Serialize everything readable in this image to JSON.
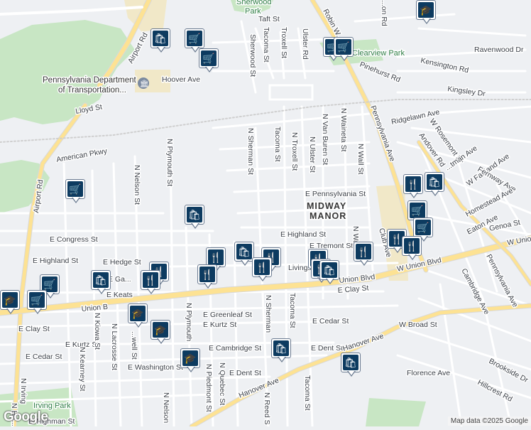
{
  "map": {
    "areas": {
      "midway_manor_line1": "MIDWAY",
      "midway_manor_line2": "MANOR"
    },
    "parks": {
      "sherwood_top": "Sherwood",
      "sherwood_bottom": "Park",
      "clearview": "Clearview Park",
      "irving": "Irving Park"
    },
    "poi": {
      "penndot_line1": "Pennsylvania Department",
      "penndot_line2": "of Transportation..."
    },
    "streets": {
      "airport_rd_n": "Airport Rd",
      "airport_rd_s": "Airport Rd",
      "hoover": "Hoover Ave",
      "lloyd": "Lloyd St",
      "american": "American Pkwy",
      "taft": "Taft St",
      "robin": "Robin W...",
      "pinehurst": "Pinehurst Rd",
      "kensington": "Kensington Rd",
      "ravenwood": "Ravenwood Dr",
      "kingsley": "Kingsley Dr",
      "ridgelawn": "Ridgelawn Ave",
      "pennsylvania_ave": "Pennsylvania Ave",
      "pennsylvania_ave_s": "Pennsylvania Ave",
      "w_rosemont": "W Rosemont Dr",
      "andover": "Andover Rd",
      "hartman": "...tman Ave",
      "fairland": "W Fairland Ave",
      "fernway": "Fernway Ave",
      "homestead": "Homestead Ave",
      "eaton": "Eaton Ave",
      "genoa": "Genoa St",
      "w_union_top": "W Union...",
      "w_union_blvd": "W Union Blvd",
      "union_blvd": "Union Blvd",
      "union_w": "Union B",
      "cambridge_ave": "Cambridge Ave",
      "e_pennsylvania": "E Pennsylvania St",
      "e_highland": "E Highland St",
      "e_highland_w": "E Highland St",
      "e_tremont": "E Tremont St",
      "e_congress": "E Congress St",
      "e_hedge": "E Hedge St",
      "e_ga": "E Ga...",
      "e_keats": "E Keats",
      "livings": "Livings...",
      "e_clay": "E Clay St",
      "e_clay_w": "E Clay St",
      "e_greenleaf": "E Greenleaf St",
      "e_kurtz": "E Kurtz St",
      "e_kurtz_w": "E Kurtz St",
      "e_cedar": "E Cedar St",
      "e_cedar_w": "E Cedar St",
      "w_broad": "W Broad St",
      "e_cambridge": "E Cambridge St",
      "e_dent": "E Dent St",
      "e_dent_w": "E Dent St",
      "e_washington": "E Washington St",
      "hanover": "Hanover Ave",
      "hanover_e": "Hanover Ave",
      "florence": "Florence Ave",
      "hillcrest": "Hillcrest Rd",
      "brookside": "Brookside Dr",
      "e_tilghman": "E Tilghman St",
      "n_sherman": "N Sherman St",
      "n_sherman_s": "N Sherman",
      "tacoma_top": "Tacoma St",
      "tacoma_mid": "Tacoma St",
      "tacoma_low": "Tacoma St",
      "tacoma_bottom": "Tacoma St",
      "troxell_top": "Troxell St",
      "n_troxell": "N Troxell St",
      "sherwood_st": "Sherwood St",
      "ulster_top": "Ulster Rd",
      "n_ulster": "N Ulster St",
      "n_van_buren": "N Van Buren St",
      "n_waineta": "N Waineta St",
      "n_wall": "N Wall St",
      "n_wa": "N Wa...",
      "club_ave": "Club Ave",
      "n_plymouth": "N Plymouth St",
      "n_plymouth_s": "N Plymouth",
      "n_nelson": "N Nelson St",
      "n_nelson_s": "N Nelson",
      "n_kiowa": "N Kiowa St",
      "n_lacrosse": "N Lacrosse St",
      "n_kearney": "N Kearney St",
      "n_irving": "N Irving",
      "n_ha": "N Ha...",
      "n_quebec": "N Quebec St",
      "n_piedmont": "N Piedmont St",
      "n_reed": "N Reed S",
      "well_st": "...well St",
      "sh_st": "...on Rd"
    },
    "pins": [
      {
        "type": "shopping",
        "icon": "bag"
      },
      {
        "type": "grocery",
        "icon": "cart"
      },
      {
        "type": "grocery",
        "icon": "cart"
      },
      {
        "type": "grocery",
        "icon": "cart"
      },
      {
        "type": "grocery",
        "icon": "cart"
      },
      {
        "type": "grocery",
        "icon": "cart"
      },
      {
        "type": "restaurant",
        "icon": "fork-knife"
      },
      {
        "type": "shopping",
        "icon": "bag"
      },
      {
        "type": "grocery",
        "icon": "cart"
      },
      {
        "type": "grocery",
        "icon": "cart"
      },
      {
        "type": "grocery",
        "icon": "cart"
      },
      {
        "type": "shopping",
        "icon": "bag"
      },
      {
        "type": "restaurant",
        "icon": "fork-knife"
      },
      {
        "type": "restaurant",
        "icon": "fork-knife"
      },
      {
        "type": "restaurant",
        "icon": "fork-knife"
      },
      {
        "type": "restaurant",
        "icon": "fork-knife"
      },
      {
        "type": "restaurant",
        "icon": "fork-knife"
      },
      {
        "type": "shopping",
        "icon": "bag"
      },
      {
        "type": "restaurant",
        "icon": "fork-knife"
      },
      {
        "type": "restaurant",
        "icon": "fork-knife"
      },
      {
        "type": "restaurant",
        "icon": "fork-knife"
      },
      {
        "type": "restaurant",
        "icon": "fork-knife"
      },
      {
        "type": "shopping",
        "icon": "bag"
      },
      {
        "type": "restaurant",
        "icon": "fork-knife"
      },
      {
        "type": "restaurant",
        "icon": "fork-knife"
      },
      {
        "type": "grocery",
        "icon": "cart"
      },
      {
        "type": "grocery",
        "icon": "cart"
      },
      {
        "type": "shopping",
        "icon": "bag"
      },
      {
        "type": "restaurant",
        "icon": "fork-knife"
      },
      {
        "type": "school",
        "icon": "graduation-cap"
      },
      {
        "type": "school",
        "icon": "graduation-cap"
      },
      {
        "type": "school",
        "icon": "graduation-cap"
      },
      {
        "type": "school",
        "icon": "graduation-cap"
      },
      {
        "type": "shopping",
        "icon": "bag"
      },
      {
        "type": "shopping",
        "icon": "bag"
      },
      {
        "type": "school",
        "icon": "graduation-cap"
      },
      {
        "type": "restaurant",
        "icon": "fork-knife"
      },
      {
        "type": "restaurant",
        "icon": "fork-knife"
      }
    ],
    "colors": {
      "park": "#c8e6c4",
      "road_major": "#fde293",
      "road_minor": "#ffffff",
      "land": "#eef0f3",
      "pin_icon": "#0d3b60"
    }
  },
  "footer": {
    "logo": "Google",
    "attribution": "Map data ©2025 Google"
  }
}
